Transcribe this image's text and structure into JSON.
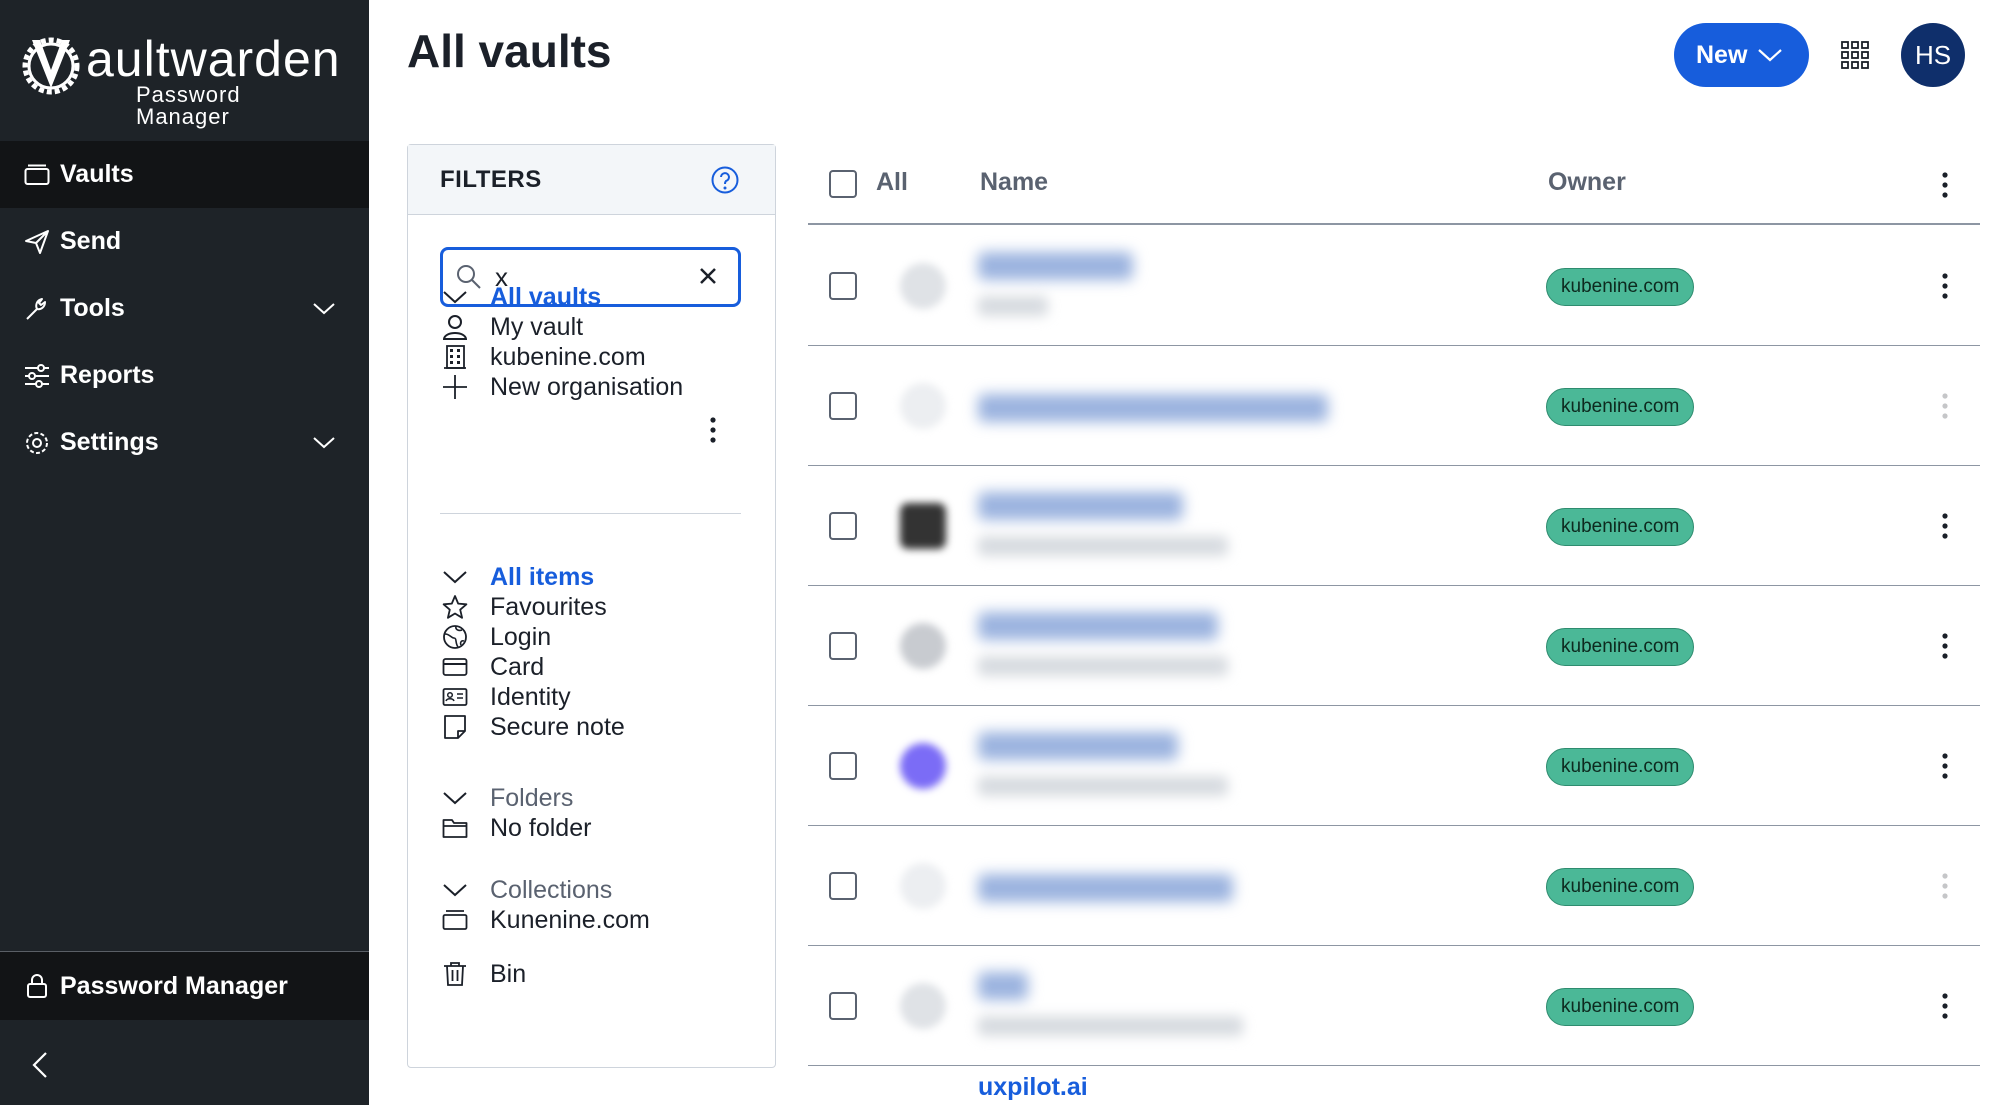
{
  "brand": {
    "wordmark": "aultwarden",
    "subtitle": "Password Manager"
  },
  "sidebar": {
    "items": [
      {
        "label": "Vaults",
        "icon": "vault-icon",
        "active": true
      },
      {
        "label": "Send",
        "icon": "send-icon"
      },
      {
        "label": "Tools",
        "icon": "wrench-icon",
        "expandable": true
      },
      {
        "label": "Reports",
        "icon": "sliders-icon"
      },
      {
        "label": "Settings",
        "icon": "gear-icon",
        "expandable": true
      }
    ],
    "product_switcher": "Password Manager",
    "collapse_icon": "chevron-left-icon"
  },
  "header": {
    "title": "All vaults",
    "new_button": "New",
    "apps_icon": "grid-icon",
    "avatar_initials": "HS"
  },
  "filters": {
    "title": "FILTERS",
    "search": {
      "value": "x"
    },
    "vaults_heading": "All vaults",
    "vaults": [
      "My vault",
      "kubenine.com",
      "New organisation"
    ],
    "types_heading": "All items",
    "types": [
      "Favourites",
      "Login",
      "Card",
      "Identity",
      "Secure note"
    ],
    "folders_heading": "Folders",
    "folders": [
      "No folder"
    ],
    "collections_heading": "Collections",
    "collections": [
      "Kunenine.com"
    ],
    "bin": "Bin"
  },
  "table": {
    "columns": {
      "all": "All",
      "name": "Name",
      "owner": "Owner"
    },
    "rows": [
      {
        "owner": "kubenine.com"
      },
      {
        "owner": "kubenine.com"
      },
      {
        "owner": "kubenine.com"
      },
      {
        "owner": "kubenine.com"
      },
      {
        "owner": "kubenine.com"
      },
      {
        "owner": "kubenine.com"
      },
      {
        "owner": "kubenine.com"
      }
    ],
    "partial_row_name": "uxpilot.ai"
  },
  "colors": {
    "sidebar_bg": "#1e2328",
    "accent": "#175ddc",
    "badge": "#4bb897",
    "avatar": "#0f2f6b"
  }
}
